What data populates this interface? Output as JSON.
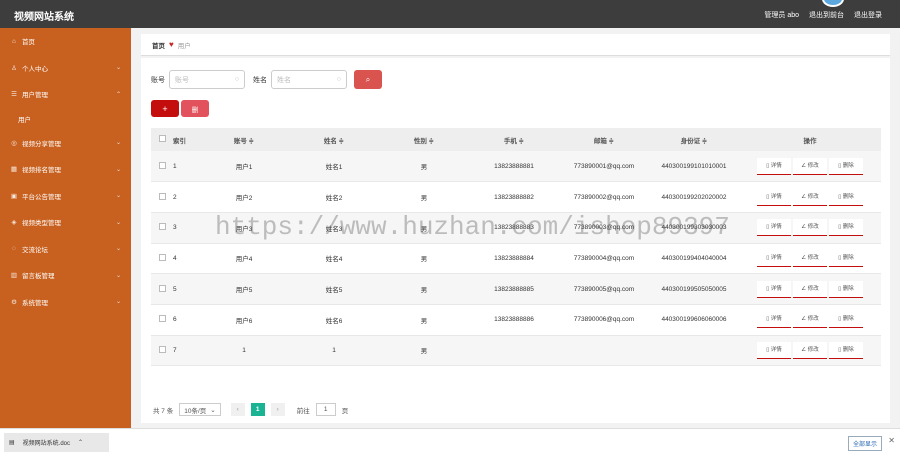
{
  "app": {
    "title": "视频网站系统"
  },
  "topbar": {
    "admin": "管理员 abo",
    "back_label": "退出到前台",
    "logout_label": "退出登录"
  },
  "sidebar": {
    "items": [
      {
        "label": "首页",
        "icon": "home-icon",
        "chevron": false
      },
      {
        "label": "个人中心",
        "icon": "user-icon",
        "chevron": true
      },
      {
        "label": "用户管理",
        "icon": "list-icon",
        "chevron": true,
        "open": true
      },
      {
        "label": "用户",
        "sub": true
      },
      {
        "label": "视频分享管理",
        "icon": "share-icon",
        "chevron": true
      },
      {
        "label": "视频排名管理",
        "icon": "rank-icon",
        "chevron": true
      },
      {
        "label": "平台公告管理",
        "icon": "notice-icon",
        "chevron": true
      },
      {
        "label": "视频类型管理",
        "icon": "tag-icon",
        "chevron": true
      },
      {
        "label": "交流论坛",
        "icon": "forum-icon",
        "chevron": true
      },
      {
        "label": "留言板管理",
        "icon": "message-icon",
        "chevron": true
      },
      {
        "label": "系统管理",
        "icon": "gear-icon",
        "chevron": true
      }
    ]
  },
  "breadcrumb": {
    "home": "首页",
    "current": "用户"
  },
  "search": {
    "account_label": "账号",
    "account_placeholder": "账号",
    "name_label": "姓名",
    "name_placeholder": "姓名"
  },
  "buttons": {
    "add": "+",
    "delete": "删"
  },
  "table": {
    "headers": [
      "索引",
      "账号 ≑",
      "姓名 ≑",
      "性别 ≑",
      "手机 ≑",
      "邮箱 ≑",
      "身份证 ≑",
      "操作"
    ],
    "ops": [
      "详情",
      "修改",
      "删除"
    ],
    "rows": [
      {
        "index": "1",
        "account": "用户1",
        "name": "姓名1",
        "gender": "男",
        "phone": "13823888881",
        "email": "773890001@qq.com",
        "idcard": "440300199101010001"
      },
      {
        "index": "2",
        "account": "用户2",
        "name": "姓名2",
        "gender": "男",
        "phone": "13823888882",
        "email": "773890002@qq.com",
        "idcard": "440300199202020002"
      },
      {
        "index": "3",
        "account": "用户3",
        "name": "姓名3",
        "gender": "男",
        "phone": "13823888883",
        "email": "773890003@qq.com",
        "idcard": "440300199303030003"
      },
      {
        "index": "4",
        "account": "用户4",
        "name": "姓名4",
        "gender": "男",
        "phone": "13823888884",
        "email": "773890004@qq.com",
        "idcard": "440300199404040004"
      },
      {
        "index": "5",
        "account": "用户5",
        "name": "姓名5",
        "gender": "男",
        "phone": "13823888885",
        "email": "773890005@qq.com",
        "idcard": "440300199505050005"
      },
      {
        "index": "6",
        "account": "用户6",
        "name": "姓名6",
        "gender": "男",
        "phone": "13823888886",
        "email": "773890006@qq.com",
        "idcard": "440300199606060006"
      },
      {
        "index": "7",
        "account": "1",
        "name": "1",
        "gender": "男",
        "phone": "",
        "email": "",
        "idcard": ""
      }
    ]
  },
  "pager": {
    "total": "共 7 条",
    "page_size": "10条/页",
    "current": "1",
    "goto_label": "前往",
    "goto_value": "1",
    "page_unit": "页"
  },
  "watermark": "https://www.huzhan.com/ishop89397",
  "download": {
    "file": "视频网站系统.doc",
    "show_all": "全部显示"
  },
  "colors": {
    "sidebar": "#c8611f",
    "topbar": "#3d3d3d",
    "primary": "#c40e0e",
    "accent": "#1ab394"
  }
}
